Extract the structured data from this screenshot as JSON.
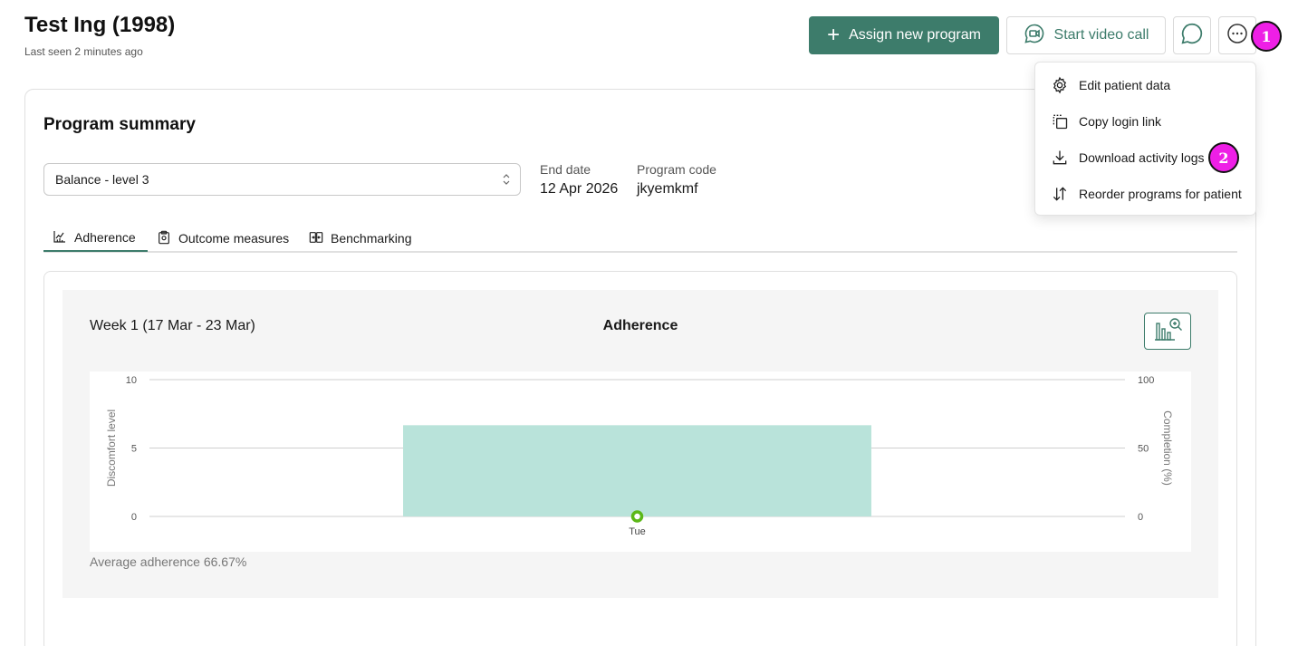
{
  "header": {
    "patient_name": "Test Ing (1998)",
    "last_seen": "Last seen 2 minutes ago",
    "assign_label": "Assign new program",
    "video_label": "Start video call"
  },
  "markers": [
    "1",
    "2"
  ],
  "menu": {
    "items": [
      {
        "label": "Edit patient data",
        "icon": "gear-icon"
      },
      {
        "label": "Copy login link",
        "icon": "copy-link-icon"
      },
      {
        "label": "Download activity logs",
        "icon": "download-icon"
      },
      {
        "label": "Reorder programs for patient",
        "icon": "reorder-icon"
      }
    ]
  },
  "summary": {
    "title": "Program summary",
    "selected_program": "Balance - level 3",
    "end_date_label": "End date",
    "end_date_value": "12 Apr 2026",
    "program_code_label": "Program code",
    "program_code_value": "jkyemkmf"
  },
  "tabs": [
    {
      "label": "Adherence",
      "icon": "chart-icon",
      "active": true
    },
    {
      "label": "Outcome measures",
      "icon": "clipboard-icon",
      "active": false
    },
    {
      "label": "Benchmarking",
      "icon": "compare-icon",
      "active": false
    }
  ],
  "chart_panel": {
    "week": "Week 1 (17 Mar - 23 Mar)",
    "title": "Adherence",
    "average": "Average adherence 66.67%"
  },
  "colors": {
    "brand": "#3d7c6b",
    "bar": "#b9e3da",
    "point": "#5cb818",
    "marker": "#ee1fe6"
  },
  "chart_data": {
    "type": "bar",
    "title": "Adherence",
    "categories": [
      "Tue"
    ],
    "series": [
      {
        "name": "Completion (%)",
        "axis": "right",
        "values": [
          66.67
        ]
      },
      {
        "name": "Discomfort level",
        "axis": "left",
        "type": "scatter",
        "values": [
          0
        ]
      }
    ],
    "ylabel": "Discomfort level",
    "ylabel_right": "Completion (%)",
    "ylim": [
      0,
      10
    ],
    "ylim_right": [
      0,
      100
    ],
    "yticks": [
      "0",
      "5",
      "10"
    ],
    "yticks_right": [
      "0",
      "50",
      "100"
    ],
    "grid": true
  }
}
